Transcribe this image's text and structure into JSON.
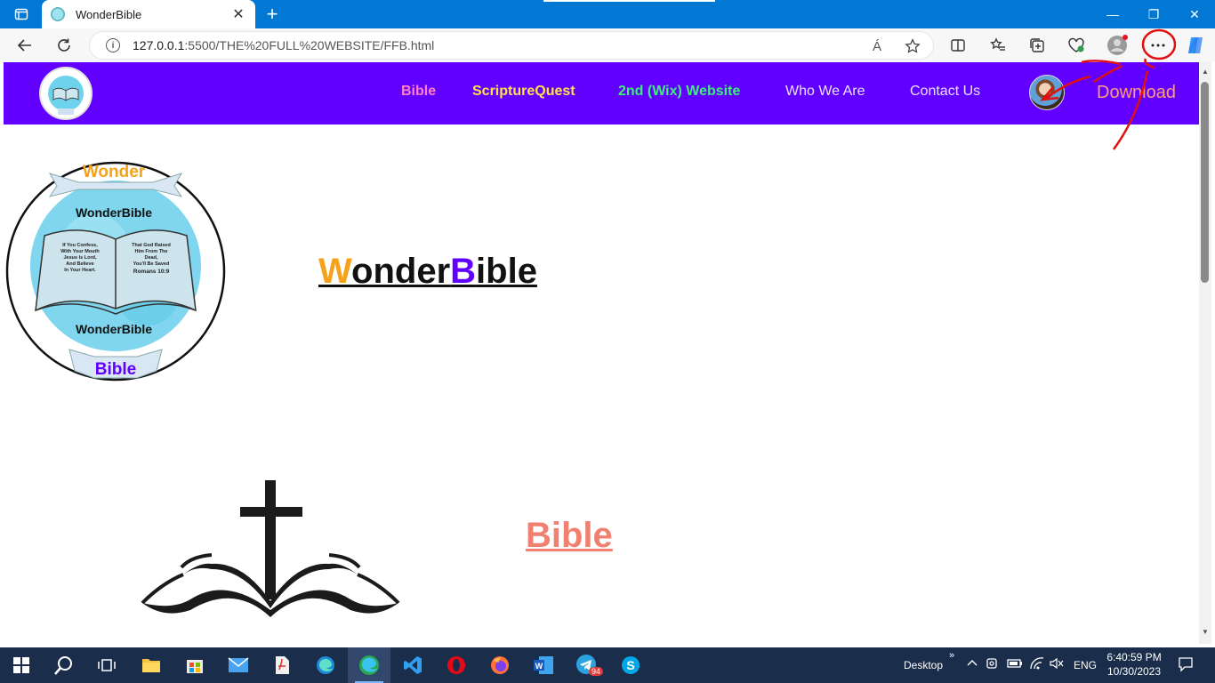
{
  "browser": {
    "tab_title": "WonderBible",
    "tab_close": "✕",
    "new_tab": "+",
    "address_host": "127.0.0.1",
    "address_path": ":5500/THE%20FULL%20WEBSITE/FFB.html",
    "read_aloud_icon": "Á",
    "window_controls": {
      "minimize": "—",
      "restore": "❐",
      "close": "✕"
    }
  },
  "site": {
    "nav_links": [
      {
        "label": "Bible",
        "color": "#ff7fbf"
      },
      {
        "label": "ScriptureQuest",
        "color": "#ffe24a"
      },
      {
        "label": "2nd (Wix) Website",
        "color": "#3cf07a"
      },
      {
        "label": "Who We Are",
        "color": "#e8e0ff"
      },
      {
        "label": "Contact Us",
        "color": "#e8e0ff"
      },
      {
        "label": "Download",
        "color": "#ff9a7a"
      }
    ],
    "nav_background": "#6200ff",
    "logo_texts": {
      "wonder": "Wonder",
      "bible": "Bible",
      "inner_top": "WonderBible",
      "inner_bottom": "WonderBible",
      "page_left": "If You Confess With Your Mouth Jesus Is Lord, And Believe In Your Heart",
      "page_right": "That God Raised Him From The Dead, You'll Be Saved Romans 10:9"
    },
    "hero_title_w": "W",
    "hero_title_onder": "onder",
    "hero_title_b": "B",
    "hero_title_ible": "ible",
    "section_title": "Bible"
  },
  "taskbar": {
    "apps": [
      "start-icon",
      "search-icon",
      "task-view-icon",
      "file-explorer-icon",
      "microsoft-store-icon",
      "mail-icon",
      "pdf-reader-icon",
      "edge-icon",
      "edge-dev-icon",
      "vscode-icon",
      "opera-icon",
      "firefox-icon",
      "word-icon",
      "telegram-icon",
      "skype-icon"
    ],
    "telegram_badge": "94",
    "desktop_label": "Desktop",
    "chevron": "»",
    "language": "ENG",
    "time": "6:40:59 PM",
    "date": "10/30/2023"
  }
}
